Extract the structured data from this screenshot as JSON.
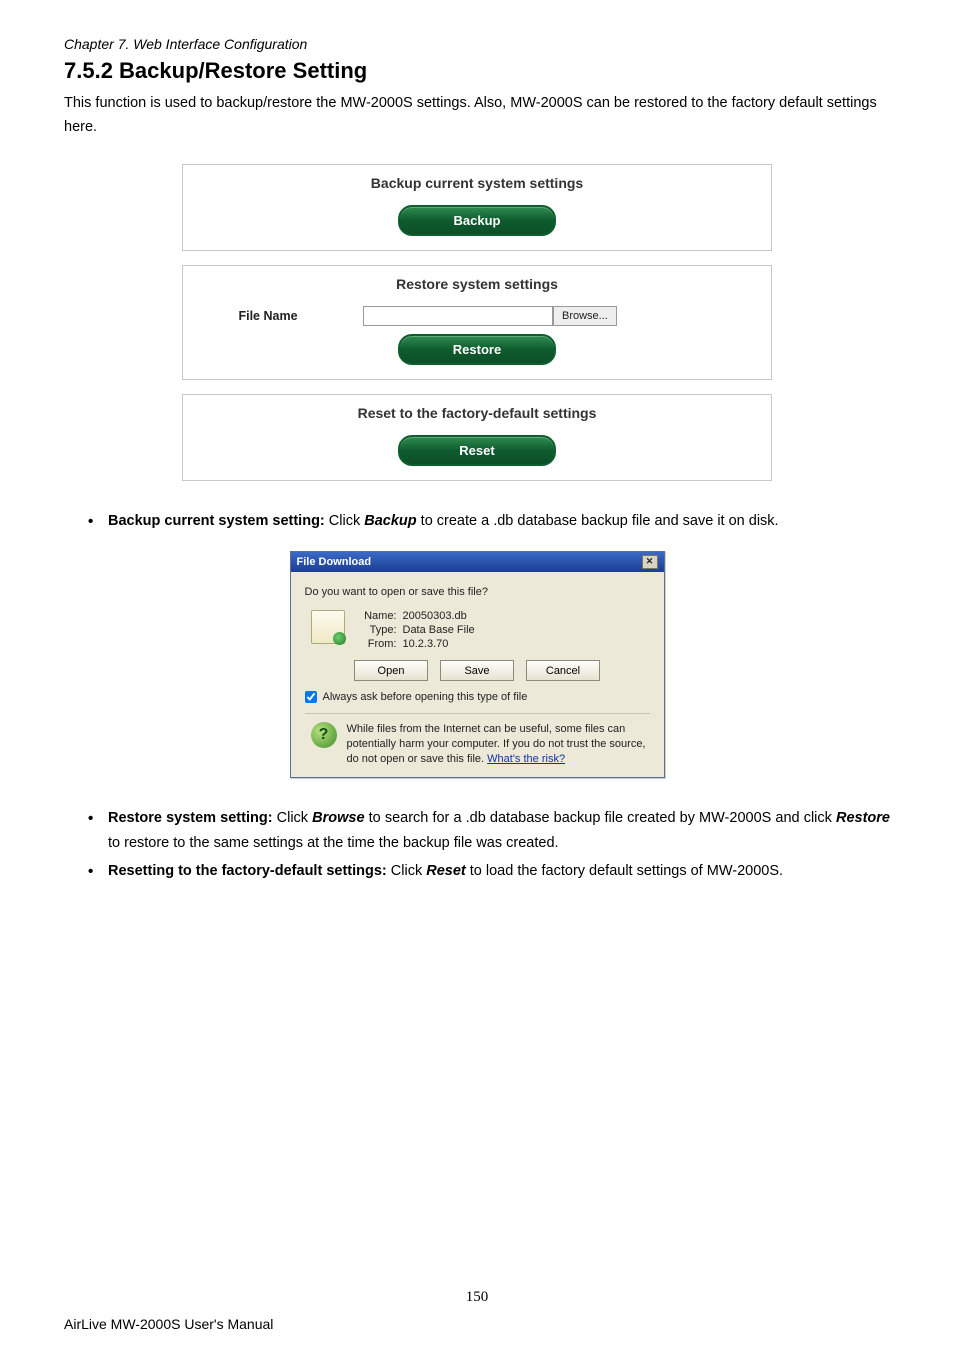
{
  "chapter_line": "Chapter 7.    Web Interface Configuration",
  "section_heading": "7.5.2  Backup/Restore Setting",
  "intro": "This function is used to backup/restore the MW-2000S settings. Also, MW-2000S can be restored to the factory default settings here.",
  "ui": {
    "backup": {
      "heading": "Backup current system settings",
      "button": "Backup"
    },
    "restore": {
      "heading": "Restore system settings",
      "file_label": "File Name",
      "file_value": "",
      "browse": "Browse...",
      "button": "Restore"
    },
    "reset": {
      "heading": "Reset to the factory-default settings",
      "button": "Reset"
    }
  },
  "bullets_top": {
    "b1_bold": "Backup current system setting:",
    "b1_rest_a": " Click ",
    "b1_bi": "Backup",
    "b1_rest_b": " to create a .db database backup file and save it on disk."
  },
  "dialog": {
    "title": "File Download",
    "question": "Do you want to open or save this file?",
    "name_k": "Name:",
    "name_v": "20050303.db",
    "type_k": "Type:",
    "type_v": "Data Base File",
    "from_k": "From:",
    "from_v": "10.2.3.70",
    "open": "Open",
    "save": "Save",
    "cancel": "Cancel",
    "always_ask": "Always ask before opening this type of file",
    "warn": "While files from the Internet can be useful, some files can potentially harm your computer. If you do not trust the source, do not open or save this file. ",
    "risk_link": "What's the risk?"
  },
  "bullets_bottom": {
    "b2_bold": "Restore system setting:",
    "b2_a": " Click ",
    "b2_bi1": "Browse",
    "b2_b": " to search for a .db database backup file created by MW-2000S and click ",
    "b2_bi2": "Restore",
    "b2_c": " to restore to the same settings at the time the backup file was created.",
    "b3_bold": "Resetting to the factory-default settings:",
    "b3_a": " Click ",
    "b3_bi": "Reset",
    "b3_b": " to load the factory default settings of MW-2000S."
  },
  "page_number": "150",
  "footer": "AirLive MW-2000S User's Manual"
}
